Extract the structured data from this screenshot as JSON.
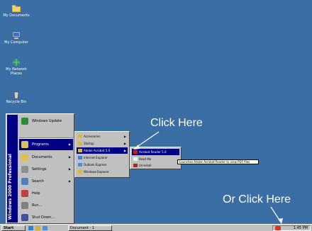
{
  "desktop": {
    "icons": [
      {
        "name": "my-documents-icon",
        "label": "My Documents"
      },
      {
        "name": "my-computer-icon",
        "label": "My Computer"
      },
      {
        "name": "network-places-icon",
        "label": "My Network Places"
      },
      {
        "name": "recycle-bin-icon",
        "label": "Recycle Bin"
      }
    ],
    "background_color": "#3a6ea5"
  },
  "start_menu": {
    "banner": "Windows 2000 Professional",
    "items": [
      {
        "label": "Windows Update",
        "icon": "globe-icon",
        "color": "#2a8a3a"
      },
      {
        "label": "Programs",
        "icon": "programs-icon",
        "color": "#d8c060",
        "highlighted": true,
        "has_submenu": true
      },
      {
        "label": "Documents",
        "icon": "documents-icon",
        "color": "#e0c050",
        "has_submenu": true
      },
      {
        "label": "Settings",
        "icon": "settings-icon",
        "color": "#909090",
        "has_submenu": true
      },
      {
        "label": "Search",
        "icon": "search-icon",
        "color": "#5080c0",
        "has_submenu": true
      },
      {
        "label": "Help",
        "icon": "help-icon",
        "color": "#c04040"
      },
      {
        "label": "Run...",
        "icon": "run-icon",
        "color": "#808080"
      },
      {
        "label": "Shut Down...",
        "icon": "shutdown-icon",
        "color": "#4050a0"
      }
    ]
  },
  "programs_menu": {
    "items": [
      {
        "label": "Accessories",
        "has_submenu": true
      },
      {
        "label": "Startup",
        "has_submenu": true
      },
      {
        "label": "Adobe Acrobat 5.0",
        "has_submenu": true,
        "highlighted": true
      },
      {
        "label": "Internet Explorer"
      },
      {
        "label": "Outlook Express"
      },
      {
        "label": "Windows Explorer"
      }
    ]
  },
  "acrobat_menu": {
    "items": [
      {
        "label": "Acrobat Reader 5.0",
        "highlighted": true
      },
      {
        "label": "Read Me"
      },
      {
        "label": "Uninstall"
      }
    ]
  },
  "tooltip": {
    "text": "Launches Adobe Acrobat Reader to view PDF files"
  },
  "taskbar": {
    "start_label": "Start",
    "task_label": "Document - 1",
    "clock": "1:45 PM"
  },
  "callouts": {
    "click_here": "Click Here",
    "or_click_here": "Or Click Here"
  },
  "colors": {
    "highlight": "#000080",
    "callout_text": "#ffffff",
    "menu_bg": "#c0c0c0"
  }
}
